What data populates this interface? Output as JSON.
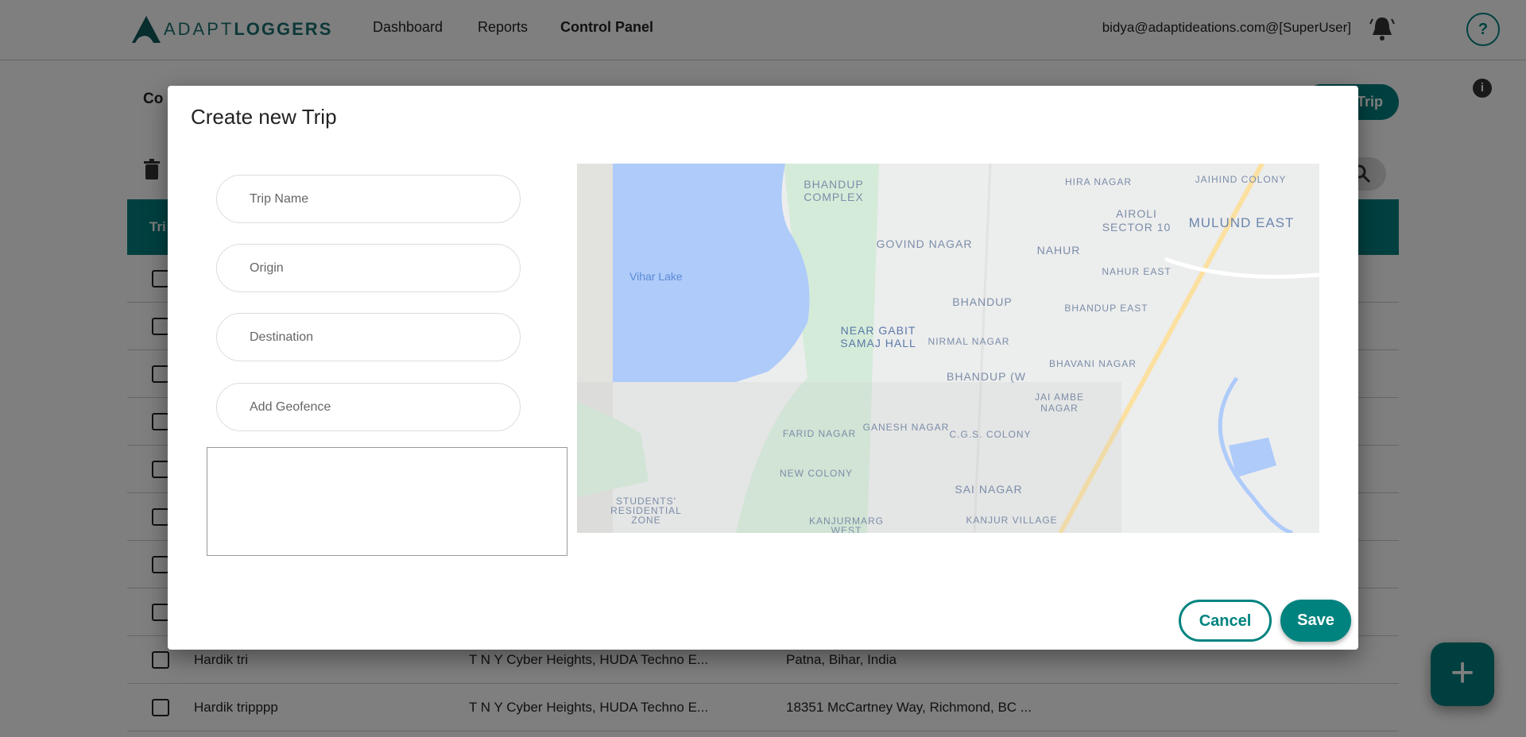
{
  "header": {
    "brand_light": "ADAPT",
    "brand_bold": "LOGGERS",
    "nav": [
      {
        "label": "Dashboard"
      },
      {
        "label": "Reports"
      },
      {
        "label": "Control Panel",
        "active": true
      }
    ],
    "user": "bidya@adaptideations.com@[SuperUser]",
    "bell_icon": "bell-icon",
    "help_label": "?"
  },
  "page": {
    "title": "Co",
    "add_button": "Trip",
    "info_label": "i",
    "table_header": "Tri"
  },
  "rows": [
    {
      "name": "",
      "origin": "",
      "destination": ""
    },
    {
      "name": "",
      "origin": "",
      "destination": ""
    },
    {
      "name": "",
      "origin": "",
      "destination": ""
    },
    {
      "name": "",
      "origin": "",
      "destination": ""
    },
    {
      "name": "",
      "origin": "",
      "destination": ""
    },
    {
      "name": "",
      "origin": "",
      "destination": ""
    },
    {
      "name": "",
      "origin": "",
      "destination": ""
    },
    {
      "name": "",
      "origin": "",
      "destination": ""
    },
    {
      "name": "Hardik tri",
      "origin": "T N Y Cyber Heights, HUDA Techno E...",
      "destination": "Patna, Bihar, India"
    },
    {
      "name": "Hardik tripppp",
      "origin": "T N Y Cyber Heights, HUDA Techno E...",
      "destination": "18351 McCartney Way, Richmond, BC ..."
    }
  ],
  "fab_label": "+",
  "modal": {
    "title": "Create new Trip",
    "fields": {
      "trip_name": {
        "placeholder": "Trip Name",
        "value": ""
      },
      "origin": {
        "placeholder": "Origin",
        "value": ""
      },
      "destination": {
        "placeholder": "Destination",
        "value": ""
      },
      "geofence": {
        "placeholder": "Add Geofence",
        "value": ""
      }
    },
    "cancel": "Cancel",
    "save": "Save",
    "map_labels": {
      "vihar": "Vihar Lake",
      "bc1": "BHANDUP",
      "bc2": "COMPLEX",
      "govind": "GOVIND NAGAR",
      "nahur": "NAHUR",
      "airoli1": "AIROLI",
      "airoli2": "SECTOR 10",
      "mulund": "MULUND EAST",
      "hira": "HIRA NAGAR",
      "jaihind": "JAIHIND COLONY",
      "nahur_east": "NAHUR EAST",
      "bhandup": "BHANDUP",
      "bhandup_east": "BHANDUP EAST",
      "gabit1": "NEAR GABIT",
      "gabit2": "SAMAJ HALL",
      "nirmal": "NIRMAL NAGAR",
      "bhavani": "BHAVANI NAGAR",
      "bhandup_w": "BHANDUP (W",
      "jai1": "JAI AMBE",
      "jai2": "NAGAR",
      "farid": "FARID NAGAR",
      "ganesh": "GANESH NAGAR",
      "cgs": "C.G.S. COLONY",
      "new_colony": "NEW COLONY",
      "sai": "SAI NAGAR",
      "stu1": "STUDENTS'",
      "stu2": "RESIDENTIAL",
      "stu3": "ZONE",
      "kanjur1": "KANJURMARG",
      "kanjur2": "WEST",
      "kanjur_village": "KANJUR VILLAGE"
    }
  },
  "colors": {
    "accent": "#00837f",
    "table_header": "#008080",
    "water": "#aecbfa",
    "park": "#d4ebd9",
    "land": "#eceded",
    "highway": "#fbe0a0"
  }
}
